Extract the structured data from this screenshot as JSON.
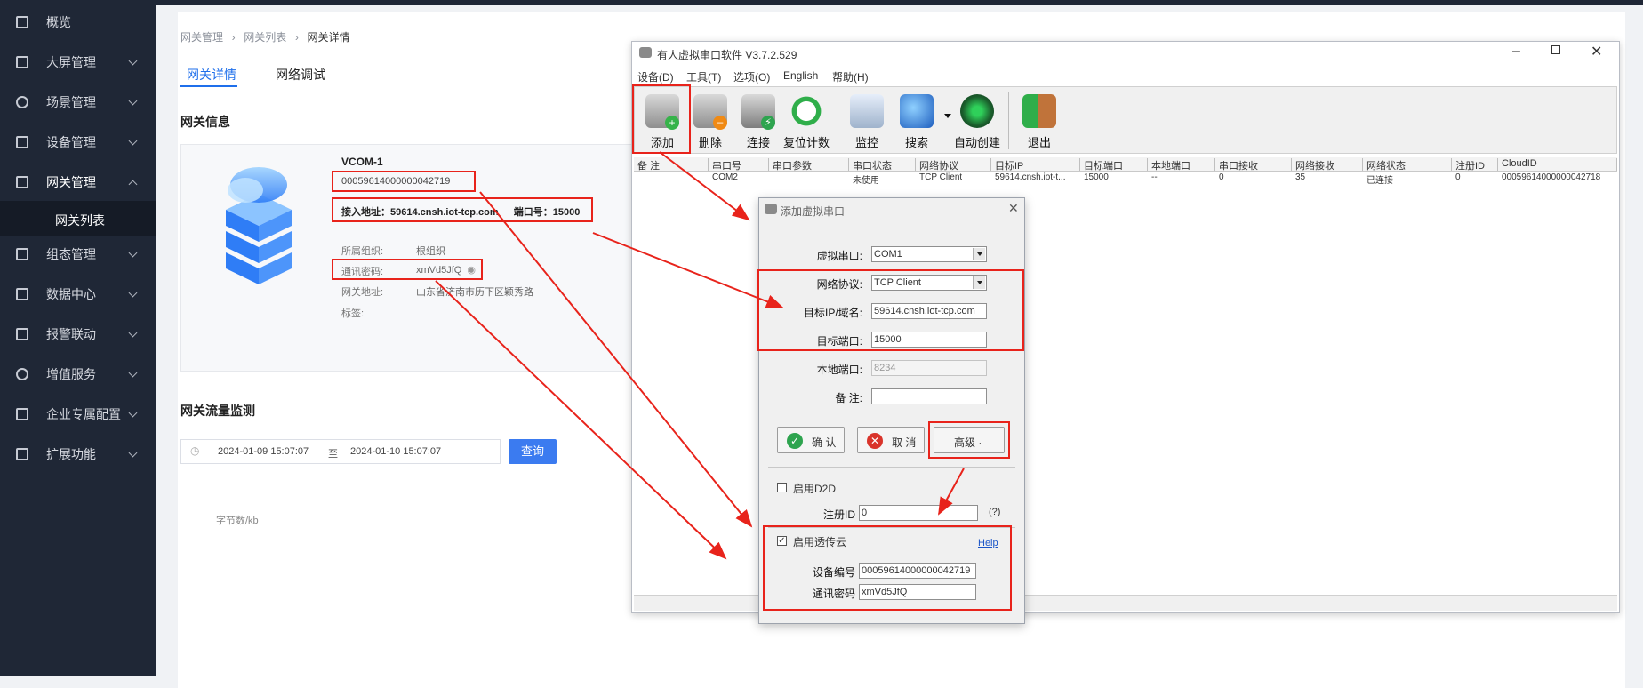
{
  "sidebar": {
    "items": [
      {
        "label": "概览"
      },
      {
        "label": "大屏管理"
      },
      {
        "label": "场景管理"
      },
      {
        "label": "设备管理"
      },
      {
        "label": "网关管理"
      },
      {
        "label": "组态管理"
      },
      {
        "label": "数据中心"
      },
      {
        "label": "报警联动"
      },
      {
        "label": "增值服务"
      },
      {
        "label": "企业专属配置"
      },
      {
        "label": "扩展功能"
      }
    ],
    "sub_item": "网关列表"
  },
  "page": {
    "breadcrumb": [
      "网关管理",
      "网关列表",
      "网关详情"
    ],
    "tabs": [
      "网关详情",
      "网络调试"
    ],
    "info_title": "网关信息",
    "device_name": "VCOM-1",
    "device_id": "00059614000000042719",
    "access_address_label": "接入地址：",
    "access_address": "59614.cnsh.iot-tcp.com",
    "port_label": "端口号：",
    "port": "15000",
    "org_label": "所属组织:",
    "org_value": "根组织",
    "password_label": "通讯密码:",
    "password_value": "xmVd5JfQ",
    "addr_label": "网关地址:",
    "addr_value": "山东省济南市历下区颖秀路",
    "tag_label": "标签:",
    "traffic_title": "网关流量监测",
    "date_start": "2024-01-09 15:07:07",
    "date_sep": "至",
    "date_end": "2024-01-10 15:07:07",
    "query_label": "查询",
    "y_axis_label": "字节数/kb"
  },
  "app": {
    "title": "有人虚拟串口软件 V3.7.2.529",
    "menu": [
      "设备(D)",
      "工具(T)",
      "选项(O)",
      "English",
      "帮助(H)"
    ],
    "toolbar": [
      "添加",
      "删除",
      "连接",
      "复位计数",
      "监控",
      "搜索",
      "自动创建",
      "退出"
    ],
    "columns": [
      "备 注",
      "串口号",
      "串口参数",
      "串口状态",
      "网络协议",
      "目标IP",
      "目标端口",
      "本地端口",
      "串口接收",
      "网络接收",
      "网络状态",
      "注册ID",
      "CloudID"
    ],
    "row": [
      "",
      "COM2",
      "",
      "未使用",
      "TCP Client",
      "59614.cnsh.iot-t...",
      "15000",
      "--",
      "0",
      "35",
      "已连接",
      "0",
      "00059614000000042718"
    ]
  },
  "dialog": {
    "title": "添加虚拟串口",
    "com_label": "虚拟串口:",
    "com_value": "COM1",
    "protocol_label": "网络协议:",
    "protocol_value": "TCP Client",
    "target_label": "目标IP/域名:",
    "target_value": "59614.cnsh.iot-tcp.com",
    "port_label": "目标端口:",
    "port_value": "15000",
    "local_port_label": "本地端口:",
    "local_port_value": "8234",
    "remark_label": "备  注:",
    "remark_value": "",
    "ok_label": "确 认",
    "cancel_label": "取 消",
    "advanced_label": "高级 ·",
    "d2d_label": "启用D2D",
    "reg_id_label": "注册ID",
    "reg_id_value": "0",
    "reg_id_help": "(?)",
    "cloud_label": "启用透传云",
    "help_link": "Help",
    "device_no_label": "设备编号",
    "device_no_value": "00059614000000042719",
    "password_label": "通讯密码",
    "password_value": "xmVd5JfQ"
  },
  "colors": {
    "sidebar_bg": "#1f2736",
    "accent": "#1f6feb",
    "highlight_red": "#e8231b"
  }
}
